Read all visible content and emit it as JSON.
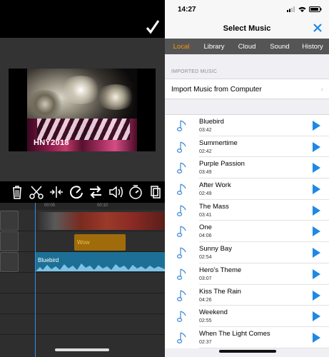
{
  "editor": {
    "preview_caption": "HNY2018",
    "ruler_labels": [
      "00:05",
      "00:10"
    ],
    "text_clip_label": "Wow",
    "music_clip_label": "Bluebird",
    "toolbar": [
      "trash-icon",
      "scissors-icon",
      "split-icon",
      "speed-icon",
      "swap-icon",
      "volume-icon",
      "timer-icon",
      "duplicate-icon"
    ]
  },
  "music": {
    "status_time": "14:27",
    "title": "Select Music",
    "tabs": [
      {
        "label": "Local",
        "active": true
      },
      {
        "label": "Library",
        "active": false
      },
      {
        "label": "Cloud",
        "active": false
      },
      {
        "label": "Sound",
        "active": false
      },
      {
        "label": "History",
        "active": false
      }
    ],
    "section_header": "IMPORTED MUSIC",
    "import_label": "Import Music from Computer",
    "songs": [
      {
        "title": "Bluebird",
        "duration": "03:42"
      },
      {
        "title": "Summertime",
        "duration": "02:42"
      },
      {
        "title": "Purple Passion",
        "duration": "03:49"
      },
      {
        "title": "After Work",
        "duration": "02:49"
      },
      {
        "title": "The Mass",
        "duration": "03:41"
      },
      {
        "title": "One",
        "duration": "04:06"
      },
      {
        "title": "Sunny Bay",
        "duration": "02:54"
      },
      {
        "title": "Hero's Theme",
        "duration": "03:07"
      },
      {
        "title": "Kiss The Rain",
        "duration": "04:26"
      },
      {
        "title": "Weekend",
        "duration": "02:55"
      },
      {
        "title": "When The Light Comes",
        "duration": "02:37"
      }
    ],
    "colors": {
      "accent": "#ff9500",
      "play": "#1e88e5",
      "close": "#1e88e5",
      "tab_bg": "#555555"
    }
  }
}
